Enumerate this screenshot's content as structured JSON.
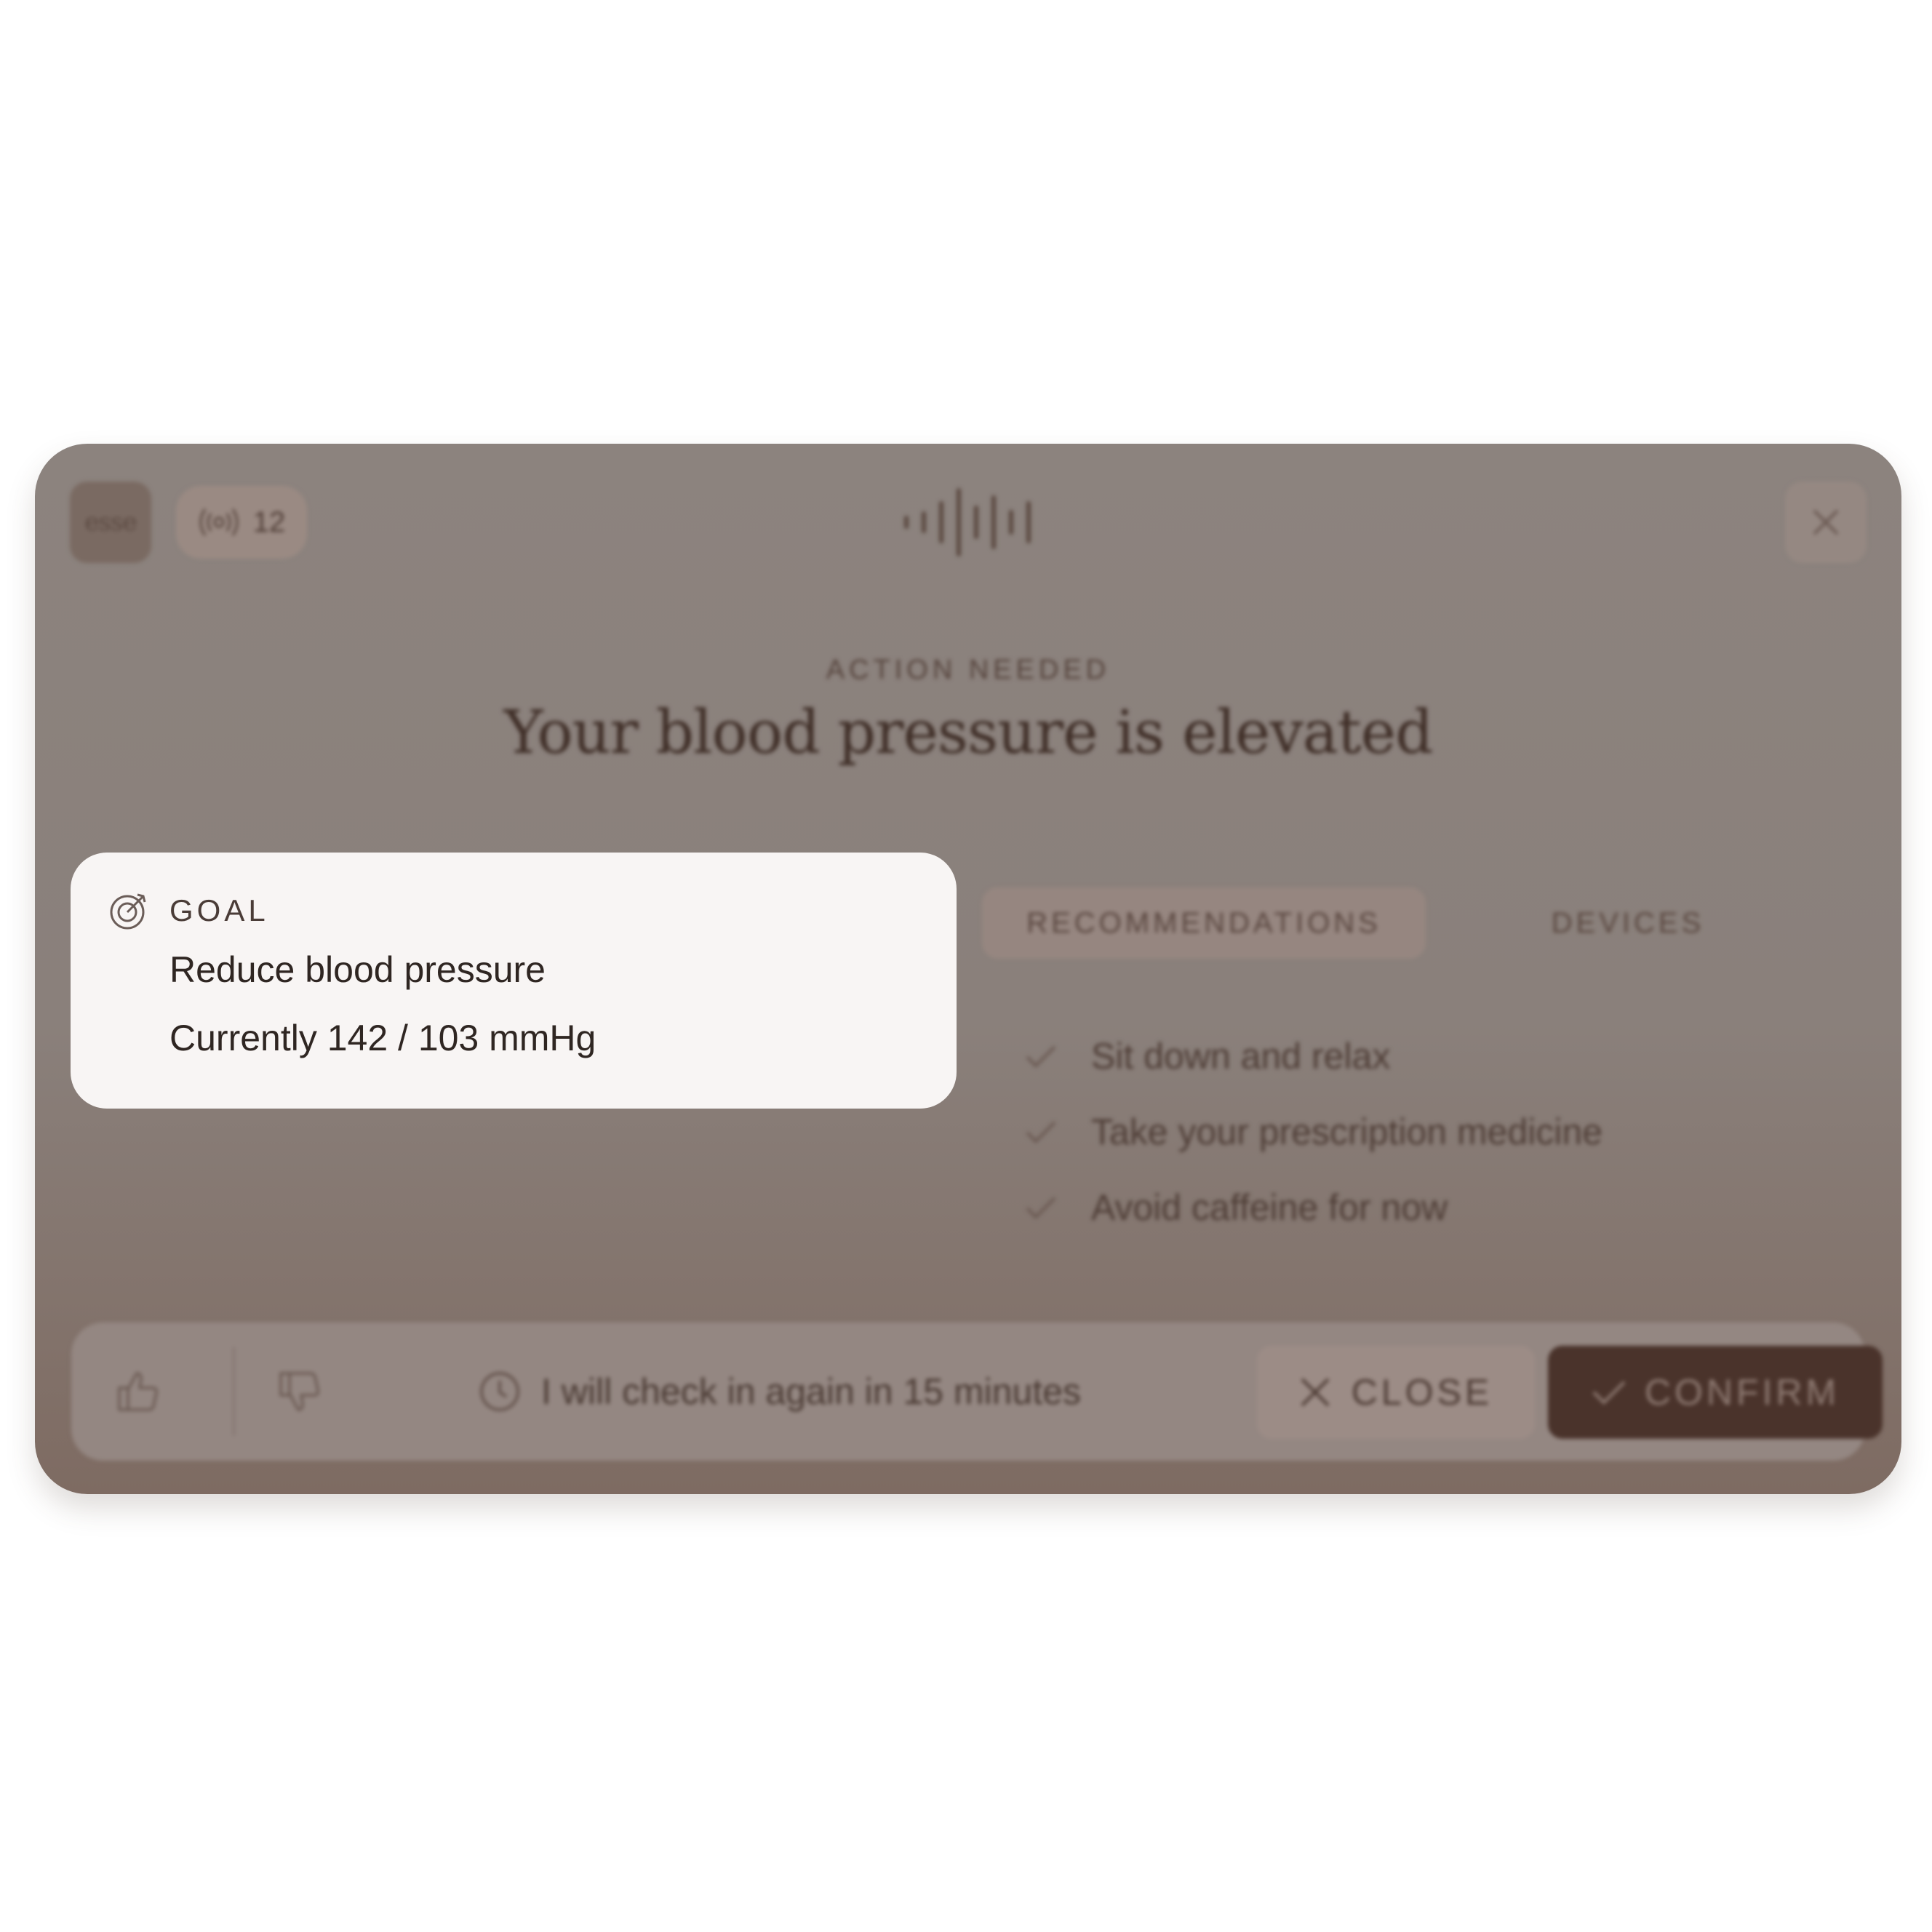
{
  "app": {
    "logo_text": "esse",
    "signal_count": "12"
  },
  "alert": {
    "eyebrow": "ACTION NEEDED",
    "headline": "Your blood pressure is elevated"
  },
  "goal": {
    "label": "GOAL",
    "title": "Reduce blood pressure",
    "reading": "Currently 142 / 103 mmHg"
  },
  "tabs": [
    {
      "label": "RECOMMENDATIONS",
      "active": true
    },
    {
      "label": "DEVICES",
      "active": false
    }
  ],
  "recommendations": [
    "Sit down and relax",
    "Take your prescription medicine",
    "Avoid caffeine for now"
  ],
  "footer": {
    "checkin_text": "I will check in again in 15 minutes",
    "close_label": "CLOSE",
    "confirm_label": "CONFIRM"
  },
  "colors": {
    "overlay": "#8a807b",
    "goal_card": "#f8f5f4",
    "confirm_button": "#4a332b"
  }
}
